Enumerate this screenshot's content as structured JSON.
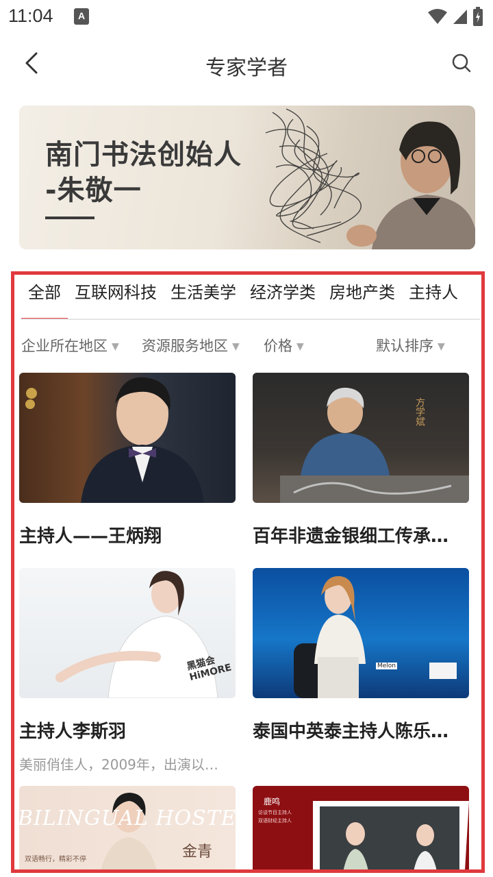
{
  "status_bar": {
    "time": "11:04",
    "notification_badge": "A"
  },
  "header": {
    "title": "专家学者"
  },
  "banner": {
    "title_line1": "南门书法创始人",
    "title_line2": "-朱敬一"
  },
  "tabs": [
    {
      "label": "全部",
      "active": true
    },
    {
      "label": "互联网科技",
      "active": false
    },
    {
      "label": "生活美学",
      "active": false
    },
    {
      "label": "经济学类",
      "active": false
    },
    {
      "label": "房地产类",
      "active": false
    },
    {
      "label": "主持人",
      "active": false
    }
  ],
  "filters": [
    {
      "label": "企业所在地区"
    },
    {
      "label": "资源服务地区"
    },
    {
      "label": "价格"
    },
    {
      "label": "默认排序"
    }
  ],
  "cards": [
    {
      "title": "主持人——王炳翔",
      "desc": ""
    },
    {
      "title": "百年非遗金银细工传承…",
      "desc": "",
      "thumb_text": "方学斌"
    },
    {
      "title": "主持人李斯羽",
      "desc": "美丽俏佳人，2009年，出演以…",
      "thumb_text": "黑猫会 HiMORE"
    },
    {
      "title": "泰国中英泰主持人陈乐…",
      "desc": "",
      "thumb_text": "Melon"
    },
    {
      "title": "",
      "desc": "",
      "thumb_text": "BILINGUAL HOSTESS",
      "thumb_text2": "金青",
      "thumb_text3": "双语畅行，精彩不停"
    },
    {
      "title": "",
      "desc": "",
      "thumb_text": "鹿鸣",
      "thumb_text2": "访谈节目主持人",
      "thumb_text3": "双语财经主持人"
    }
  ],
  "colors": {
    "accent": "#e0393e",
    "text_primary": "#222222",
    "text_secondary": "#666666",
    "text_muted": "#999999"
  }
}
